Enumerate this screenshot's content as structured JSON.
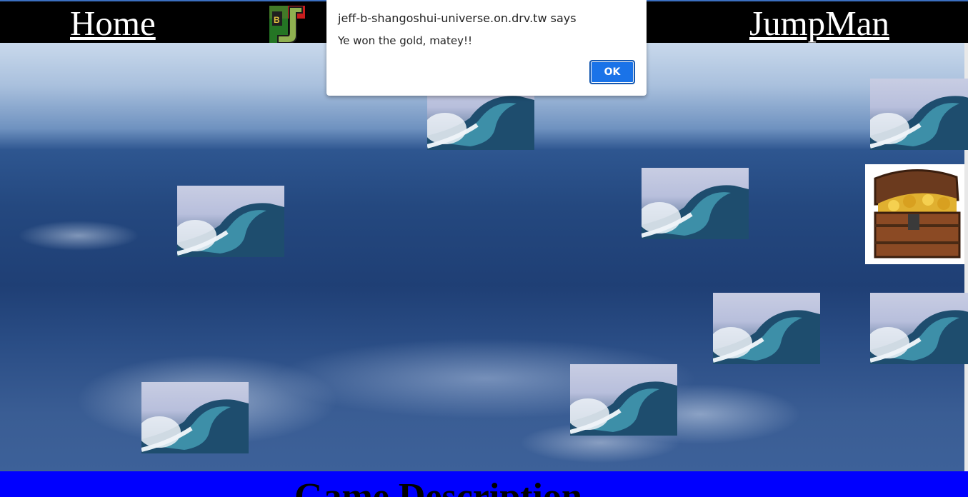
{
  "header": {
    "home_label": "Home",
    "game_label": "JumpMan",
    "logo_icon": "jb-logo-icon"
  },
  "board": {
    "tile_icon": "wave-icon",
    "goal_icon": "treasure-chest-icon",
    "wave_count": 9
  },
  "footer": {
    "title": "Game Description"
  },
  "alert": {
    "origin_text": "jeff-b-shangoshui-universe.on.drv.tw says",
    "message": "Ye won the gold, matey!!",
    "ok_label": "OK"
  },
  "colors": {
    "header_bg": "#000000",
    "footer_bg": "#0000ff",
    "ok_button": "#1a73e8"
  }
}
